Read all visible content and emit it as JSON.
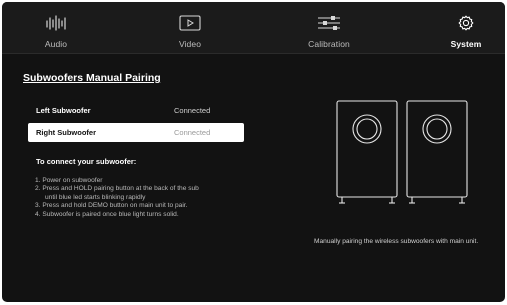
{
  "nav": {
    "tabs": [
      {
        "label": "Audio",
        "icon": "equalizer-icon",
        "active": false
      },
      {
        "label": "Video",
        "icon": "play-icon",
        "active": false
      },
      {
        "label": "Calibration",
        "icon": "sliders-icon",
        "active": false
      },
      {
        "label": "System",
        "icon": "gear-icon",
        "active": true
      }
    ]
  },
  "main": {
    "title": "Subwoofers Manual Pairing",
    "subwoofers": [
      {
        "name": "Left Subwoofer",
        "status": "Connected",
        "selected": false
      },
      {
        "name": "Right Subwoofer",
        "status": "Connected",
        "selected": true
      }
    ],
    "instructions": {
      "heading": "To connect your subwoofer:",
      "steps": [
        "1. Power on subwoofer",
        "2. Press and HOLD pairing button at the back of the sub",
        "until blue led starts blinking rapidly",
        "3. Press and hold DEMO button on main unit to pair.",
        "4. Subwoofer is paired once blue light turns solid."
      ]
    },
    "illustration": {
      "icon": "subwoofers-illustration",
      "caption": "Manually pairing the wireless subwoofers with main unit."
    }
  },
  "colors": {
    "background": "#121212",
    "nav_background": "#1b1b1b",
    "selected_row": "#ffffff",
    "muted_text": "#b9b9b9"
  }
}
